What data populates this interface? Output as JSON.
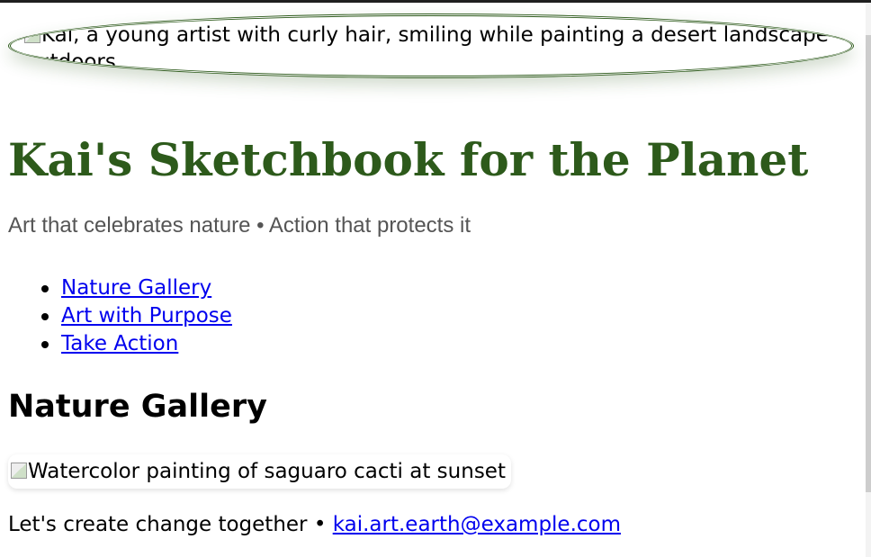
{
  "hero": {
    "image_alt": "Kai, a young artist with curly hair, smiling while painting a desert landscape outdoors"
  },
  "header": {
    "title": "Kai's Sketchbook for the Planet",
    "tagline": "Art that celebrates nature • Action that protects it"
  },
  "nav": {
    "items": [
      {
        "label": "Nature Gallery"
      },
      {
        "label": "Art with Purpose"
      },
      {
        "label": "Take Action"
      }
    ]
  },
  "gallery": {
    "heading": "Nature Gallery",
    "image_alt": "Watercolor painting of saguaro cacti at sunset"
  },
  "footer": {
    "text": "Let's create change together • ",
    "email": "kai.art.earth@example.com"
  },
  "colors": {
    "accent": "#2d5a1b",
    "link": "#0000ee",
    "tagline": "#555555"
  },
  "icons": {
    "broken_image": "broken-image-icon",
    "list_bullet": "bullet-icon"
  }
}
